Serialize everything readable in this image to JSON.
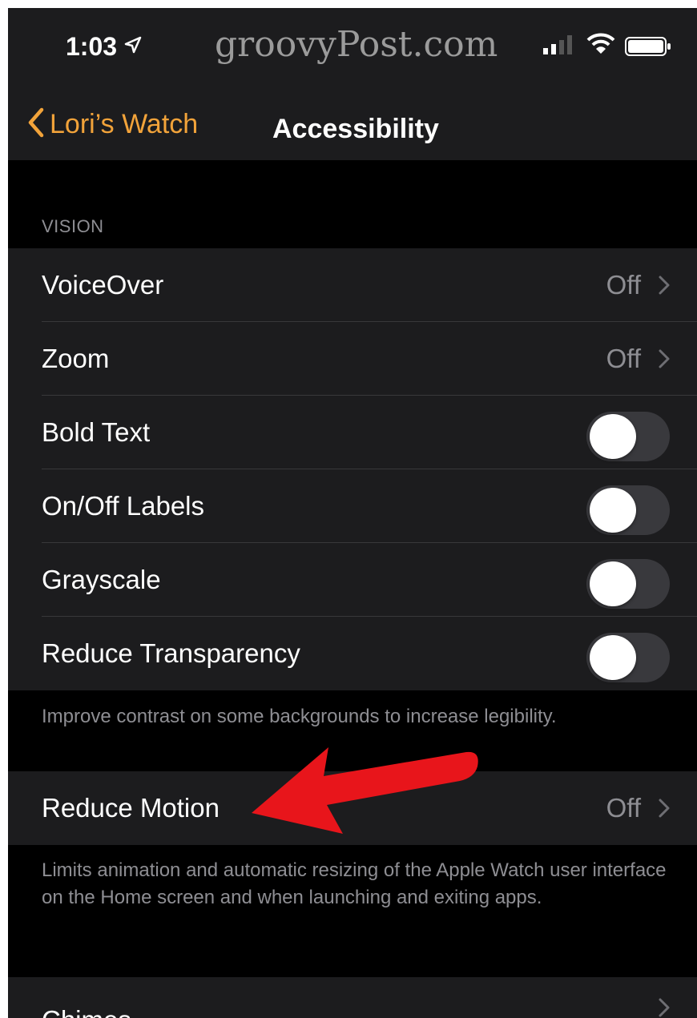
{
  "status_bar": {
    "time": "1:03",
    "watermark": "groovyPost.com",
    "location_icon": "location-arrow-icon",
    "signal_icon": "cellular-signal-icon",
    "wifi_icon": "wifi-icon",
    "battery_icon": "battery-icon"
  },
  "nav": {
    "back_label": "Lori’s Watch",
    "title": "Accessibility"
  },
  "vision": {
    "header": "VISION",
    "rows": [
      {
        "label": "VoiceOver",
        "value": "Off"
      },
      {
        "label": "Zoom",
        "value": "Off"
      },
      {
        "label": "Bold Text",
        "toggle": false
      },
      {
        "label": "On/Off Labels",
        "toggle": false
      },
      {
        "label": "Grayscale",
        "toggle": false
      },
      {
        "label": "Reduce Transparency",
        "toggle": false
      }
    ],
    "footnote": "Improve contrast on some backgrounds to increase legibility."
  },
  "motion": {
    "label": "Reduce Motion",
    "value": "Off",
    "footnote": "Limits animation and automatic resizing of the Apple Watch user interface on the Home screen and when launching and exiting apps."
  },
  "chimes": {
    "label": "Chimes"
  },
  "colors": {
    "accent": "#f2a33a",
    "annotation_arrow": "#e8151b",
    "cell_background": "#1c1c1e",
    "background": "#000000"
  }
}
